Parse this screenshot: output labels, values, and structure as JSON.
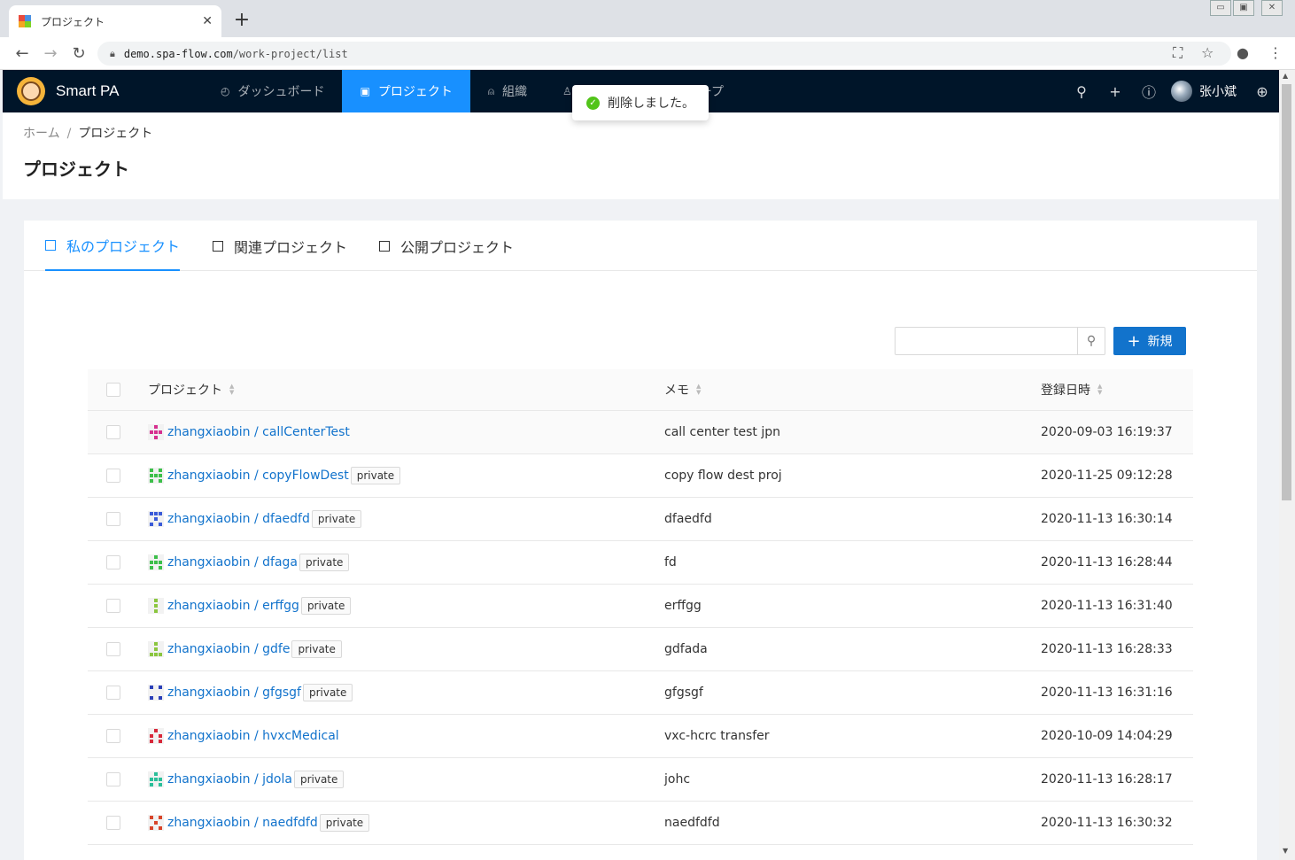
{
  "browser": {
    "tab_title": "プロジェクト",
    "tab_close": "✕",
    "new_tab": "+",
    "url_host": "demo.spa-flow.com",
    "url_path": "/work-project/list"
  },
  "app": {
    "name": "Smart PA",
    "menu": [
      {
        "label": "ダッシュボード",
        "active": false
      },
      {
        "label": "プロジェクト",
        "active": true
      },
      {
        "label": "組織",
        "active": false
      },
      {
        "label": "ループ",
        "active": false
      }
    ],
    "user_name": "张小斌"
  },
  "toast": {
    "message": "削除しました。"
  },
  "page": {
    "breadcrumb_home": "ホーム",
    "breadcrumb_sep": "/",
    "breadcrumb_current": "プロジェクト",
    "title": "プロジェクト"
  },
  "tabs": [
    {
      "label": "私のプロジェクト",
      "active": true
    },
    {
      "label": "関連プロジェクト",
      "active": false
    },
    {
      "label": "公開プロジェクト",
      "active": false
    }
  ],
  "toolbar": {
    "search_value": "",
    "new_button": "新規"
  },
  "table": {
    "columns": [
      "プロジェクト",
      "メモ",
      "登録日時"
    ],
    "rows": [
      {
        "project": "zhangxiaobin / callCenterTest",
        "private": "",
        "memo": "call center test jpn",
        "date": "2020-09-03 16:19:37",
        "icon_color": "#d6308f"
      },
      {
        "project": "zhangxiaobin / copyFlowDest",
        "private": "private",
        "memo": "copy flow dest proj",
        "date": "2020-11-25 09:12:28",
        "icon_color": "#3cbf4a"
      },
      {
        "project": "zhangxiaobin / dfaedfd",
        "private": "private",
        "memo": "dfaedfd",
        "date": "2020-11-13 16:30:14",
        "icon_color": "#3b5bd8"
      },
      {
        "project": "zhangxiaobin / dfaga",
        "private": "private",
        "memo": "fd",
        "date": "2020-11-13 16:28:44",
        "icon_color": "#3cbf4a"
      },
      {
        "project": "zhangxiaobin / erffgg",
        "private": "private",
        "memo": "erffgg",
        "date": "2020-11-13 16:31:40",
        "icon_color": "#8bc63f"
      },
      {
        "project": "zhangxiaobin / gdfe",
        "private": "private",
        "memo": "gdfada",
        "date": "2020-11-13 16:28:33",
        "icon_color": "#8bc63f"
      },
      {
        "project": "zhangxiaobin / gfgsgf",
        "private": "private",
        "memo": "gfgsgf",
        "date": "2020-11-13 16:31:16",
        "icon_color": "#2a3fb8"
      },
      {
        "project": "zhangxiaobin / hvxcMedical",
        "private": "",
        "memo": "vxc-hcrc transfer",
        "date": "2020-10-09 14:04:29",
        "icon_color": "#d8283a"
      },
      {
        "project": "zhangxiaobin / jdola",
        "private": "private",
        "memo": "johc",
        "date": "2020-11-13 16:28:17",
        "icon_color": "#2bbf9a"
      },
      {
        "project": "zhangxiaobin / naedfdfd",
        "private": "private",
        "memo": "naedfdfd",
        "date": "2020-11-13 16:30:32",
        "icon_color": "#d8452a"
      }
    ]
  }
}
